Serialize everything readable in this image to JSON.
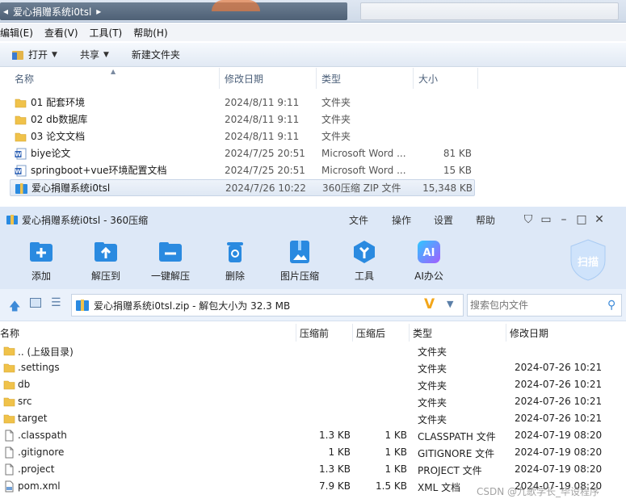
{
  "explorer": {
    "breadcrumb": [
      "爱心捐赠系统i0tsl"
    ],
    "menu": [
      "编辑(E)",
      "查看(V)",
      "工具(T)",
      "帮助(H)"
    ],
    "toolbar": {
      "open": "打开",
      "share": "共享",
      "new_folder": "新建文件夹"
    },
    "columns": {
      "name": "名称",
      "date": "修改日期",
      "type": "类型",
      "size": "大小"
    },
    "rows": [
      {
        "name": "01 配套环境",
        "date": "2024/8/11 9:11",
        "type": "文件夹",
        "size": "",
        "icon": "folder-icon"
      },
      {
        "name": "02 db数据库",
        "date": "2024/8/11 9:11",
        "type": "文件夹",
        "size": "",
        "icon": "folder-icon"
      },
      {
        "name": "03 论文文档",
        "date": "2024/8/11 9:11",
        "type": "文件夹",
        "size": "",
        "icon": "folder-icon"
      },
      {
        "name": "biye论文",
        "date": "2024/7/25 20:51",
        "type": "Microsoft Word ...",
        "size": "81 KB",
        "icon": "word-doc-icon"
      },
      {
        "name": "springboot+vue环境配置文档",
        "date": "2024/7/25 20:51",
        "type": "Microsoft Word ...",
        "size": "15 KB",
        "icon": "word-doc-icon"
      },
      {
        "name": "爱心捐赠系统i0tsl",
        "date": "2024/7/26 10:22",
        "type": "360压缩 ZIP 文件",
        "size": "15,348 KB",
        "icon": "zip-archive-icon"
      }
    ]
  },
  "zip": {
    "title": "爱心捐赠系统i0tsl - 360压缩",
    "menu": [
      "文件",
      "操作",
      "设置",
      "帮助"
    ],
    "tools": [
      {
        "label": "添加",
        "icon": "add-icon"
      },
      {
        "label": "解压到",
        "icon": "extract-to-icon"
      },
      {
        "label": "一键解压",
        "icon": "one-click-extract-icon"
      },
      {
        "label": "删除",
        "icon": "delete-icon"
      },
      {
        "label": "图片压缩",
        "icon": "image-compress-icon"
      },
      {
        "label": "工具",
        "icon": "tools-icon"
      },
      {
        "label": "AI办公",
        "icon": "ai-office-icon"
      }
    ],
    "scan_label": "扫描",
    "path": "爱心捐赠系统i0tsl.zip - 解包大小为 32.3 MB",
    "search_placeholder": "搜索包内文件",
    "columns": {
      "name": "名称",
      "before": "压缩前",
      "after": "压缩后",
      "type": "类型",
      "date": "修改日期"
    },
    "rows": [
      {
        "name": ".. (上级目录)",
        "before": "",
        "after": "",
        "type": "文件夹",
        "date": "",
        "icon": "folder-icon"
      },
      {
        "name": ".settings",
        "before": "",
        "after": "",
        "type": "文件夹",
        "date": "2024-07-26 10:21",
        "icon": "folder-icon"
      },
      {
        "name": "db",
        "before": "",
        "after": "",
        "type": "文件夹",
        "date": "2024-07-26 10:21",
        "icon": "folder-icon"
      },
      {
        "name": "src",
        "before": "",
        "after": "",
        "type": "文件夹",
        "date": "2024-07-26 10:21",
        "icon": "folder-icon"
      },
      {
        "name": "target",
        "before": "",
        "after": "",
        "type": "文件夹",
        "date": "2024-07-26 10:21",
        "icon": "folder-icon"
      },
      {
        "name": ".classpath",
        "before": "1.3 KB",
        "after": "1 KB",
        "type": "CLASSPATH 文件",
        "date": "2024-07-19 08:20",
        "icon": "file-icon"
      },
      {
        "name": ".gitignore",
        "before": "1 KB",
        "after": "1 KB",
        "type": "GITIGNORE 文件",
        "date": "2024-07-19 08:20",
        "icon": "file-icon"
      },
      {
        "name": ".project",
        "before": "1.3 KB",
        "after": "1 KB",
        "type": "PROJECT 文件",
        "date": "2024-07-19 08:20",
        "icon": "file-icon"
      },
      {
        "name": "pom.xml",
        "before": "7.9 KB",
        "after": "1.5 KB",
        "type": "XML 文档",
        "date": "2024-07-19 08:20",
        "icon": "xml-file-icon"
      }
    ]
  },
  "watermark": "CSDN @九歌学长_毕设程序",
  "colors": {
    "folder": "#f0c24a",
    "accent_blue": "#2a8ae0",
    "zip_bg": "#dde8f7",
    "selected_row": "#dfe8f4"
  }
}
